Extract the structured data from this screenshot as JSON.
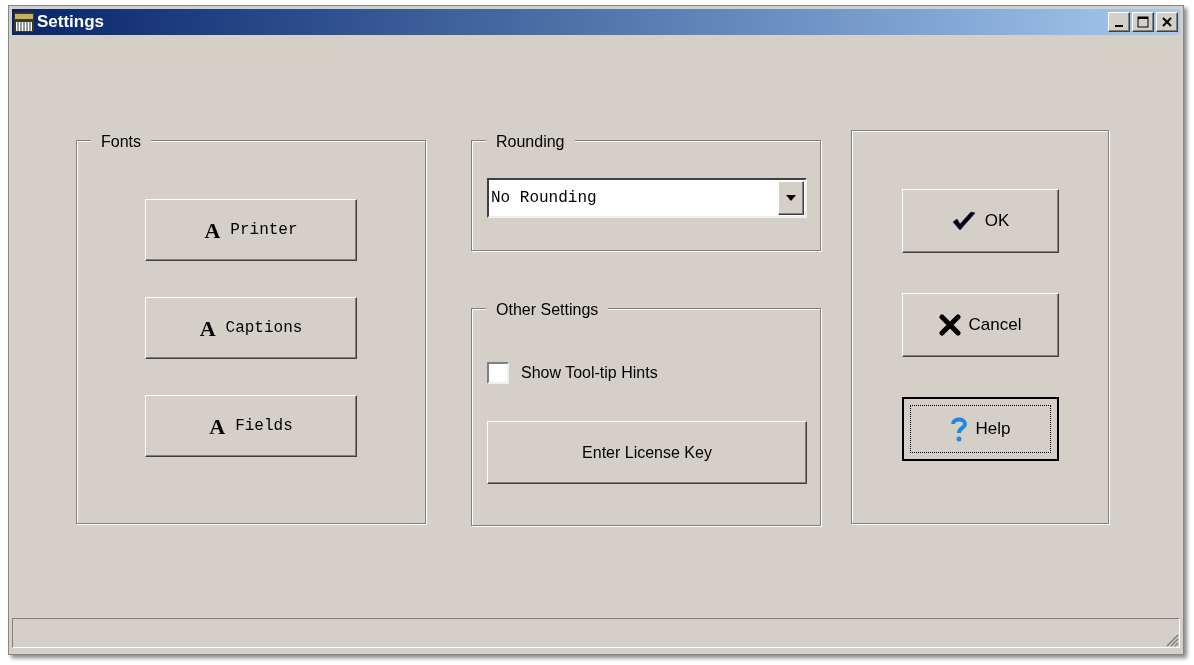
{
  "window": {
    "title": "Settings"
  },
  "fonts_group": {
    "title": "Fonts",
    "buttons": [
      {
        "glyph": "A",
        "label": "Printer"
      },
      {
        "glyph": "A",
        "label": "Captions"
      },
      {
        "glyph": "A",
        "label": "Fields"
      }
    ]
  },
  "rounding_group": {
    "title": "Rounding",
    "dropdown": {
      "value": "No Rounding"
    }
  },
  "other_group": {
    "title": "Other Settings",
    "checkbox": {
      "label": "Show Tool-tip Hints",
      "checked": false
    },
    "button": "Enter License Key"
  },
  "actions": [
    {
      "kind": "ok",
      "label": "OK",
      "focused": false
    },
    {
      "kind": "cancel",
      "label": "Cancel",
      "focused": false
    },
    {
      "kind": "help",
      "label": "Help",
      "focused": true
    }
  ]
}
